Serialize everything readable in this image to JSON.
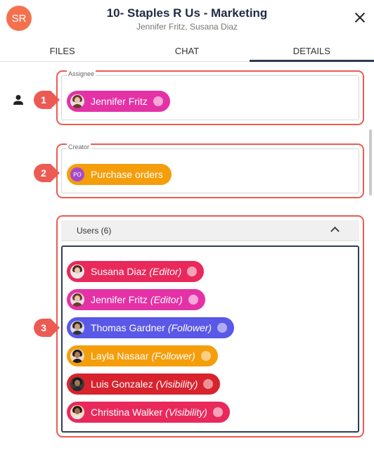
{
  "header": {
    "avatar_initials": "SR",
    "title": "10- Staples R Us - Marketing",
    "subtitle": "Jennifer Fritz, Susana Diaz"
  },
  "tabs": [
    {
      "label": "FILES",
      "active": false
    },
    {
      "label": "CHAT",
      "active": false
    },
    {
      "label": "DETAILS",
      "active": true
    }
  ],
  "markers": [
    "1",
    "2",
    "3"
  ],
  "assignee": {
    "label": "Assignee",
    "chip": {
      "name": "Jennifer Fritz",
      "color": "#e531a6"
    }
  },
  "creator": {
    "label": "Creator",
    "chip": {
      "badge": "PO",
      "name": "Purchase orders",
      "color": "#f59e0b"
    }
  },
  "users": {
    "title": "Users (6)",
    "items": [
      {
        "name": "Susana Diaz",
        "role": "(Editor)",
        "color": "#e9295b"
      },
      {
        "name": "Jennifer Fritz",
        "role": "(Editor)",
        "color": "#e531a6"
      },
      {
        "name": "Thomas Gardner",
        "role": "(Follower)",
        "color": "#5a58e6"
      },
      {
        "name": "Layla Nasaar",
        "role": "(Follower)",
        "color": "#f59e0b"
      },
      {
        "name": "Luis Gonzalez",
        "role": "(Visibility)",
        "color": "#d8232e"
      },
      {
        "name": "Christina Walker",
        "role": "(Visibility)",
        "color": "#e9295b"
      }
    ]
  },
  "colors": {
    "accent": "#2b3a55",
    "highlight": "#ec5b53",
    "avatar_bg": "#f4714e"
  }
}
